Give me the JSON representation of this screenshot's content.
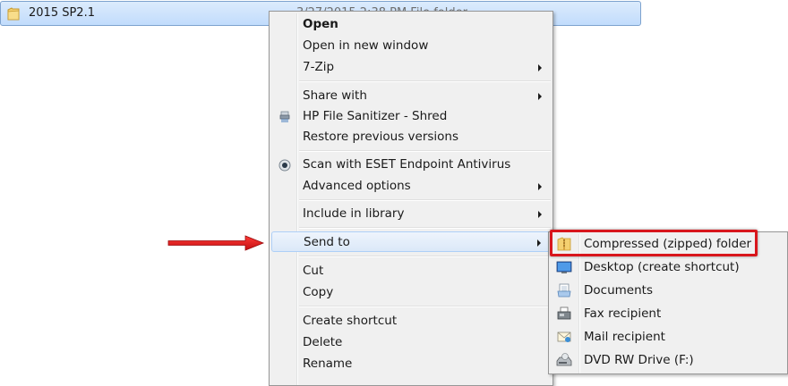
{
  "file_row": {
    "name": "2015 SP2.1",
    "meta": "3/27/2015 2:38 PM     File folder"
  },
  "context_menu": {
    "items": [
      {
        "label": "Open",
        "bold": true
      },
      {
        "label": "Open in new window"
      },
      {
        "label": "7-Zip",
        "submenu": true
      },
      {
        "label": "Share with",
        "submenu": true
      },
      {
        "label": "HP File Sanitizer - Shred",
        "icon": "shredder-icon"
      },
      {
        "label": "Restore previous versions"
      },
      {
        "label": "Scan with ESET Endpoint Antivirus",
        "icon": "eset-icon"
      },
      {
        "label": "Advanced options",
        "submenu": true
      },
      {
        "label": "Include in library",
        "submenu": true
      },
      {
        "label": "Send to",
        "submenu": true,
        "highlighted": true
      },
      {
        "label": "Cut"
      },
      {
        "label": "Copy"
      },
      {
        "label": "Create shortcut"
      },
      {
        "label": "Delete"
      },
      {
        "label": "Rename"
      }
    ]
  },
  "send_to_menu": {
    "items": [
      {
        "label": "Compressed (zipped) folder",
        "icon": "zip-folder-icon",
        "annotated": true
      },
      {
        "label": "Desktop (create shortcut)",
        "icon": "desktop-icon"
      },
      {
        "label": "Documents",
        "icon": "documents-icon"
      },
      {
        "label": "Fax recipient",
        "icon": "fax-icon"
      },
      {
        "label": "Mail recipient",
        "icon": "mail-icon"
      },
      {
        "label": "DVD RW Drive (F:)",
        "icon": "dvd-drive-icon"
      }
    ]
  },
  "annotation": {
    "arrow_color": "#e0161c",
    "box_color": "#d8161c"
  }
}
